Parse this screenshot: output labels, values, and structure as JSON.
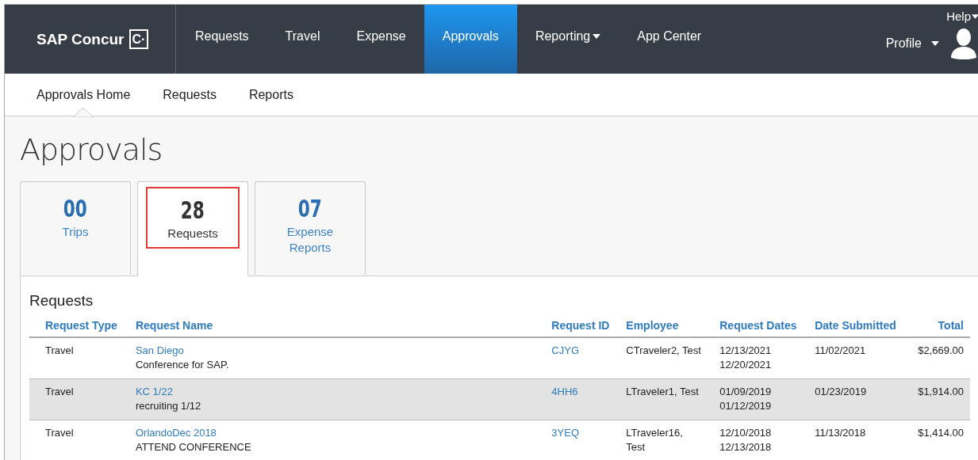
{
  "brand": {
    "name": "SAP Concur",
    "mark": "C·"
  },
  "nav": [
    {
      "label": "Requests",
      "selected": false,
      "dropdown": false
    },
    {
      "label": "Travel",
      "selected": false,
      "dropdown": false
    },
    {
      "label": "Expense",
      "selected": false,
      "dropdown": false
    },
    {
      "label": "Approvals",
      "selected": true,
      "dropdown": false
    },
    {
      "label": "Reporting",
      "selected": false,
      "dropdown": true
    },
    {
      "label": "App Center",
      "selected": false,
      "dropdown": false
    }
  ],
  "help": "Help",
  "profile": "Profile",
  "subnav": [
    {
      "label": "Approvals Home",
      "selected": true
    },
    {
      "label": "Requests",
      "selected": false
    },
    {
      "label": "Reports",
      "selected": false
    }
  ],
  "page_title": "Approvals",
  "summary_tabs": [
    {
      "count": "00",
      "label": "Trips",
      "selected": false,
      "highlighted": false
    },
    {
      "count": "28",
      "label": "Requests",
      "selected": true,
      "highlighted": true
    },
    {
      "count": "07",
      "label": "Expense Reports",
      "selected": false,
      "highlighted": false
    }
  ],
  "table": {
    "title": "Requests",
    "columns": [
      "Request Type",
      "Request Name",
      "Request ID",
      "Employee",
      "Request Dates",
      "Date Submitted",
      "Total"
    ],
    "rows": [
      {
        "type": "Travel",
        "name": "San Diego",
        "description": "Conference for SAP.",
        "id": "CJYG",
        "employee": [
          "CTraveler2, Test"
        ],
        "dates": [
          "12/13/2021",
          "12/20/2021"
        ],
        "submitted": "11/02/2021",
        "total": "$2,669.00",
        "selected": false
      },
      {
        "type": "Travel",
        "name": "KC 1/22",
        "description": "recruiting 1/12",
        "id": "4HH6",
        "employee": [
          "LTraveler1, Test"
        ],
        "dates": [
          "01/09/2019",
          "01/12/2019"
        ],
        "submitted": "01/23/2019",
        "total": "$1,914.00",
        "selected": true
      },
      {
        "type": "Travel",
        "name": "OrlandoDec 2018",
        "description": "ATTEND CONFERENCE",
        "id": "3YEQ",
        "employee": [
          "LTraveler16,",
          "Test"
        ],
        "dates": [
          "12/10/2018",
          "12/13/2018"
        ],
        "submitted": "11/13/2018",
        "total": "$1,414.00",
        "selected": false
      }
    ]
  }
}
